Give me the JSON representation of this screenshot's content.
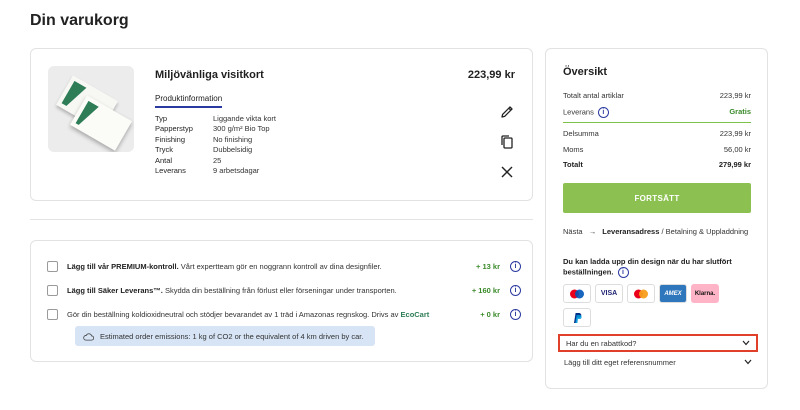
{
  "page": {
    "title": "Din varukorg"
  },
  "product": {
    "name": "Miljövänliga visitkort",
    "price": "223,99 kr",
    "tab_label": "Produktinformation",
    "specs": [
      {
        "key": "Typ",
        "value": "Liggande vikta kort"
      },
      {
        "key": "Papperstyp",
        "value": "300 g/m² Bio Top"
      },
      {
        "key": "Finishing",
        "value": "No finishing"
      },
      {
        "key": "Tryck",
        "value": "Dubbelsidig"
      },
      {
        "key": "Antal",
        "value": "25"
      },
      {
        "key": "Leverans",
        "value": "9 arbetsdagar"
      }
    ],
    "actions": [
      "edit-icon",
      "duplicate-icon",
      "close-icon"
    ]
  },
  "addons": [
    {
      "bold": "Lägg till vår PREMIUM-kontroll.",
      "text": " Vårt expertteam gör en noggrann kontroll av dina designfiler.",
      "price": "+ 13 kr"
    },
    {
      "bold": "Lägg till Säker Leverans™.",
      "text": " Skydda din beställning från förlust eller förseningar under transporten.",
      "price": "+ 160 kr"
    },
    {
      "bold": "",
      "text": "Gör din beställning koldioxidneutral och stödjer bevarandet av 1 träd i Amazonas regnskog. Drivs av ",
      "brand": "EcoCart",
      "price": "+ 0 kr"
    }
  ],
  "emission_note": "Estimated order emissions: 1 kg of CO2 or the equivalent of 4 km driven by car.",
  "info_glyph": "i",
  "summary": {
    "title": "Översikt",
    "rows_top": [
      {
        "label": "Totalt antal artiklar",
        "value": "223,99 kr"
      },
      {
        "label": "Leverans",
        "value": "Gratis"
      }
    ],
    "rows_bottom": [
      {
        "label": "Delsumma",
        "value": "223,99 kr"
      },
      {
        "label": "Moms",
        "value": "56,00 kr"
      },
      {
        "label": "Totalt",
        "value": "279,99 kr"
      }
    ],
    "cta_label": "FORTSÄTT",
    "next_prefix": "Nästa",
    "next_arrow": "→",
    "next_bold": "Leveransadress",
    "next_rest": " / Betalning & Uppladdning",
    "upload_note": "Du kan ladda upp din design när du har slutfört beställningen.",
    "payments": [
      "Mastercard",
      "VISA",
      "Maestro",
      "AMEX",
      "Klarna.",
      "PayPal"
    ],
    "discount_label": "Har du en rabattkod?",
    "reference_label": "Lägg till ditt eget referensnummer"
  },
  "colors": {
    "accent": "#2b3aa0",
    "cta": "#8cc152",
    "price_green": "#3a8a2a",
    "highlight": "#e0402a"
  }
}
